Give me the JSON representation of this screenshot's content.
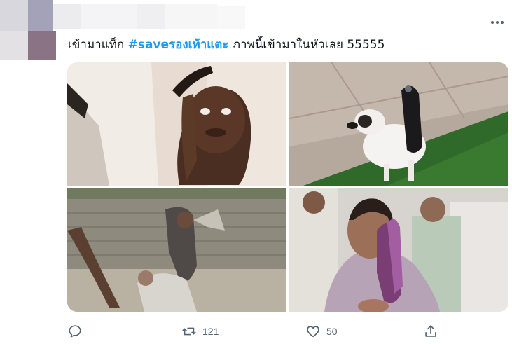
{
  "tweet": {
    "text_prefix": "เข้ามาแท็ก ",
    "hashtag": "#saveรองเท้าแตะ",
    "text_suffix": " ภาพนี้เข้ามาในหัวเลย 55555"
  },
  "media": [
    {
      "icon": "photo-boy-raising-slipper"
    },
    {
      "icon": "photo-dog-with-slipper"
    },
    {
      "icon": "photo-man-hitting-with-slipper"
    },
    {
      "icon": "photo-woman-holding-slipper"
    }
  ],
  "actions": {
    "reply_icon": "reply-icon",
    "retweet_icon": "retweet-icon",
    "retweet_count": "121",
    "like_icon": "like-icon",
    "like_count": "50",
    "share_icon": "share-icon"
  },
  "colors": {
    "hashtag": "#1d9bf0",
    "icon_gray": "#536471",
    "text": "#0f1419"
  }
}
